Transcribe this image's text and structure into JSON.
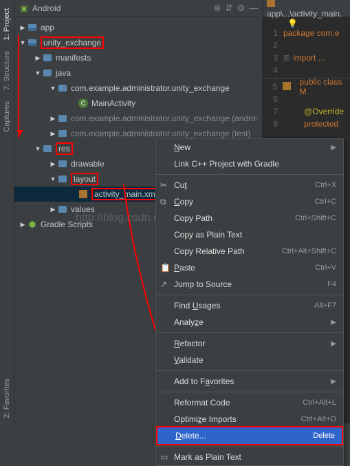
{
  "header": {
    "label": "Android"
  },
  "sidebar": {
    "tabs": [
      "1: Project",
      "7: Structure",
      "Captures",
      "2: Favorites"
    ]
  },
  "tree": {
    "app": "app",
    "module": "unity_exchange",
    "manifests": "manifests",
    "java": "java",
    "pkg_main": "com.example.administrator.unity_exchange",
    "main_activity": "MainActivity",
    "pkg_android": "com.example.administrator.unity_exchange (androidTest)",
    "pkg_test": "com.example.administrator.unity_exchange (test)",
    "res": "res",
    "drawable": "drawable",
    "layout": "layout",
    "activity_xml": "activity_main.xml",
    "values": "values",
    "gradle": "Gradle Scripts"
  },
  "editor": {
    "tab": "app\\...\\activity_main.",
    "l1": "package com.e",
    "l3": "import ...",
    "l5": "public class M",
    "l7": "@Override",
    "l8": "protected"
  },
  "menu": {
    "new": "New",
    "link": "Link C++ Project with Gradle",
    "cut": "Cut",
    "cut_sc": "Ctrl+X",
    "copy": "Copy",
    "copy_sc": "Ctrl+C",
    "copypath": "Copy Path",
    "copypath_sc": "Ctrl+Shift+C",
    "copyplain": "Copy as Plain Text",
    "copyrel": "Copy Relative Path",
    "copyrel_sc": "Ctrl+Alt+Shift+C",
    "paste": "Paste",
    "paste_sc": "Ctrl+V",
    "jump": "Jump to Source",
    "jump_sc": "F4",
    "findusages": "Find Usages",
    "findusages_sc": "Alt+F7",
    "analyze": "Analyze",
    "refactor": "Refactor",
    "validate": "Validate",
    "addfav": "Add to Favorites",
    "reformat": "Reformat Code",
    "reformat_sc": "Ctrl+Alt+L",
    "optimize": "Optimize Imports",
    "optimize_sc": "Ctrl+Alt+O",
    "delete": "Delete...",
    "delete_sc": "Delete",
    "markplain": "Mark as Plain Text"
  },
  "watermark": "http://blog.csdn.net/BuladeMian"
}
